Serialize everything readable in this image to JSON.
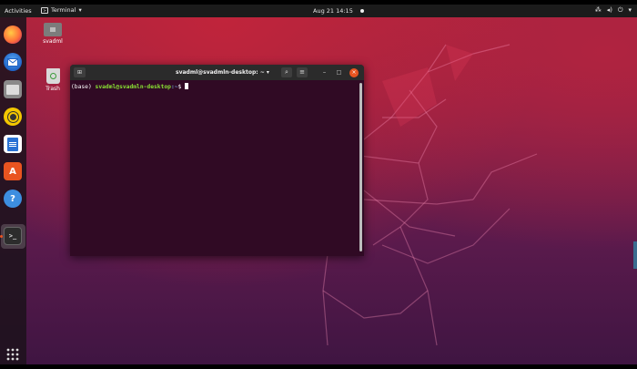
{
  "topbar": {
    "activities": "Activities",
    "app_name": "Terminal",
    "clock": "Aug 21  14:15",
    "tray_icons": [
      "network-icon",
      "volume-icon",
      "power-icon"
    ]
  },
  "dock": {
    "items": [
      {
        "name": "firefox",
        "label": "Firefox"
      },
      {
        "name": "thunderbird",
        "label": "Thunderbird"
      },
      {
        "name": "files",
        "label": "Files"
      },
      {
        "name": "rhythmbox",
        "label": "Rhythmbox"
      },
      {
        "name": "writer",
        "label": "LibreOffice Writer"
      },
      {
        "name": "software",
        "label": "Ubuntu Software"
      },
      {
        "name": "help",
        "label": "Help"
      },
      {
        "name": "terminal",
        "label": "Terminal"
      }
    ],
    "show_apps": "Show Applications"
  },
  "desktop_icons": {
    "home": "svadml",
    "trash": "Trash"
  },
  "terminal": {
    "title": "svadml@svadmln-desktop: ~",
    "prompt_env": "(base) ",
    "prompt_user": "svadml@svadmln-desktop",
    "prompt_path": ":~",
    "prompt_symbol": "$ "
  },
  "colors": {
    "accent": "#e95420",
    "terminal_bg": "#300a24",
    "prompt_user": "#8ae234",
    "prompt_path": "#729fcf"
  }
}
